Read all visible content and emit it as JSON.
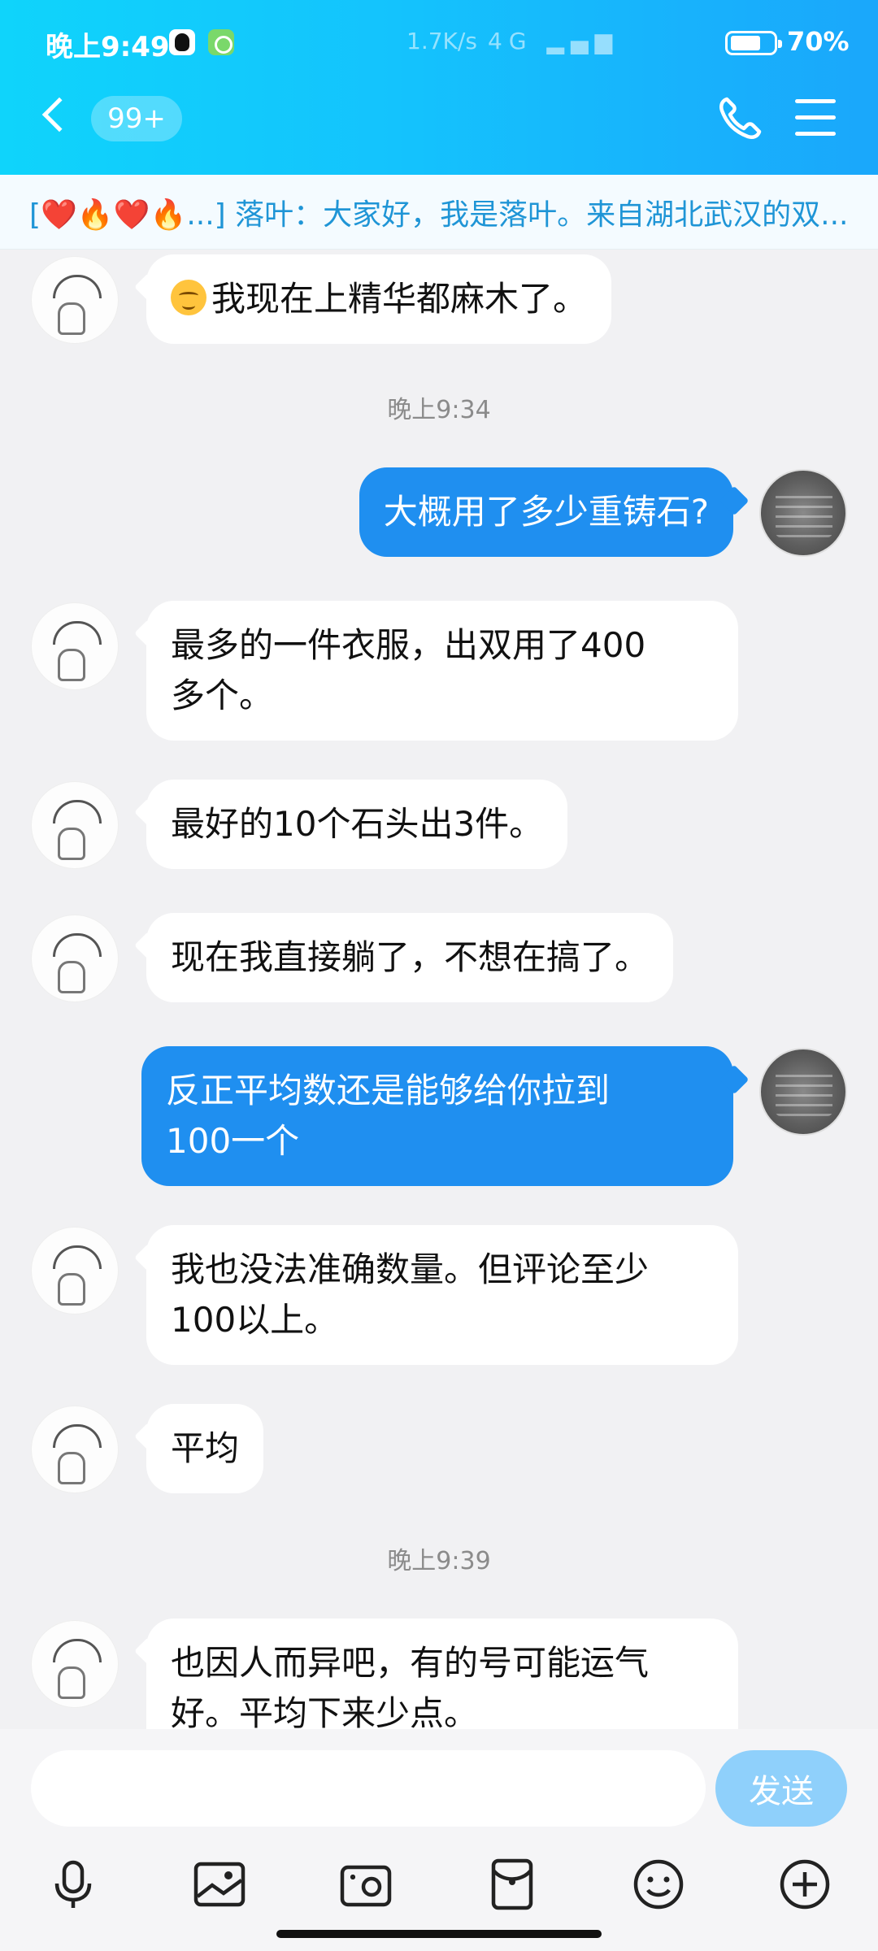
{
  "status": {
    "time": "晚上9:49",
    "speed": "1.7K/s",
    "signal": "4G",
    "battery": "70%"
  },
  "header": {
    "unread": "99+"
  },
  "banner": {
    "text": "[❤️🔥❤️🔥...] 落叶：大家好，我是落叶。来自湖北武汉的双..."
  },
  "messages": [
    {
      "text": "我现在上精华都麻木了。"
    },
    {
      "time": "晚上9:34"
    },
    {
      "text": "大概用了多少重铸石?"
    },
    {
      "line1": "最多的一件衣服，出双用了400",
      "line2": "多个。"
    },
    {
      "text": "最好的10个石头出3件。"
    },
    {
      "text": "现在我直接躺了，不想在搞了。"
    },
    {
      "line1": "反正平均数还是能够给你拉到",
      "line2": "100一个"
    },
    {
      "line1": "我也没法准确数量。但评论至少",
      "line2": "100以上。"
    },
    {
      "text": "平均"
    },
    {
      "time": "晚上9:39"
    },
    {
      "line1": "也因人而异吧，有的号可能运气",
      "line2": "好。平均下来少点。"
    }
  ],
  "input": {
    "value": "",
    "send_label": "发送"
  }
}
